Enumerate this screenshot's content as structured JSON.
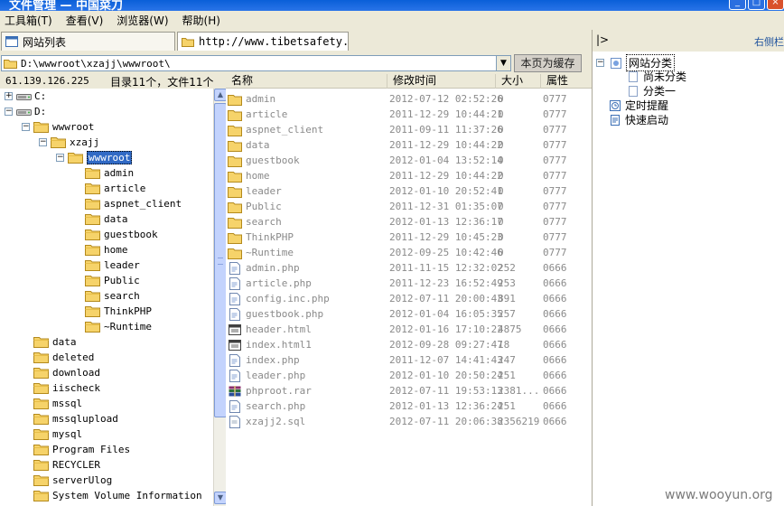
{
  "window": {
    "title": "文件管理 — 中国菜刀"
  },
  "menubar": [
    "工具箱(T)",
    "查看(V)",
    "浏览器(W)",
    "帮助(H)"
  ],
  "tabs": [
    {
      "label": "网站列表",
      "active": false
    },
    {
      "label": "http://www.tibetsafety.g...",
      "active": true
    }
  ],
  "right_panel": {
    "collapse_arrow": "|>",
    "title": "右侧栏",
    "tree": [
      {
        "label": "网站分类",
        "level": 0,
        "icon": "folder-category-icon",
        "expanded": true,
        "selected": true
      },
      {
        "label": "尚未分类",
        "level": 1,
        "icon": "doc-icon"
      },
      {
        "label": "分类一",
        "level": 1,
        "icon": "doc-icon"
      },
      {
        "label": "定时提醒",
        "level": 0,
        "icon": "clock-icon"
      },
      {
        "label": "快速启动",
        "level": 0,
        "icon": "doc-icon"
      }
    ]
  },
  "address": {
    "path": "D:\\wwwroot\\xzajj\\wwwroot\\",
    "cache_button": "本页为缓存"
  },
  "status": {
    "ip": "61.139.126.225",
    "summary": "目录11个，文件11个"
  },
  "tree": [
    {
      "label": "C:",
      "level": 0,
      "type": "drive",
      "toggle": "+"
    },
    {
      "label": "D:",
      "level": 0,
      "type": "drive",
      "toggle": "-"
    },
    {
      "label": "wwwroot",
      "level": 1,
      "type": "folder",
      "toggle": "-"
    },
    {
      "label": "xzajj",
      "level": 2,
      "type": "folder",
      "toggle": "-"
    },
    {
      "label": "wwwroot",
      "level": 3,
      "type": "folder",
      "toggle": "-",
      "selected": true
    },
    {
      "label": "admin",
      "level": 4,
      "type": "folder"
    },
    {
      "label": "article",
      "level": 4,
      "type": "folder"
    },
    {
      "label": "aspnet_client",
      "level": 4,
      "type": "folder"
    },
    {
      "label": "data",
      "level": 4,
      "type": "folder"
    },
    {
      "label": "guestbook",
      "level": 4,
      "type": "folder"
    },
    {
      "label": "home",
      "level": 4,
      "type": "folder"
    },
    {
      "label": "leader",
      "level": 4,
      "type": "folder"
    },
    {
      "label": "Public",
      "level": 4,
      "type": "folder"
    },
    {
      "label": "search",
      "level": 4,
      "type": "folder"
    },
    {
      "label": "ThinkPHP",
      "level": 4,
      "type": "folder"
    },
    {
      "label": "~Runtime",
      "level": 4,
      "type": "folder"
    },
    {
      "label": "data",
      "level": 1,
      "type": "folder"
    },
    {
      "label": "deleted",
      "level": 1,
      "type": "folder"
    },
    {
      "label": "download",
      "level": 1,
      "type": "folder"
    },
    {
      "label": "iischeck",
      "level": 1,
      "type": "folder"
    },
    {
      "label": "mssql",
      "level": 1,
      "type": "folder"
    },
    {
      "label": "mssqlupload",
      "level": 1,
      "type": "folder"
    },
    {
      "label": "mysql",
      "level": 1,
      "type": "folder"
    },
    {
      "label": "Program Files",
      "level": 1,
      "type": "folder"
    },
    {
      "label": "RECYCLER",
      "level": 1,
      "type": "folder"
    },
    {
      "label": "serverUlog",
      "level": 1,
      "type": "folder"
    },
    {
      "label": "System Volume Information",
      "level": 1,
      "type": "folder"
    }
  ],
  "list_columns": [
    "名称",
    "修改时间",
    "大小",
    "属性"
  ],
  "files": [
    {
      "name": "admin",
      "time": "2012-07-12 02:52:26",
      "size": "0",
      "attr": "0777",
      "icon": "folder"
    },
    {
      "name": "article",
      "time": "2011-12-29 10:44:21",
      "size": "0",
      "attr": "0777",
      "icon": "folder"
    },
    {
      "name": "aspnet_client",
      "time": "2011-09-11 11:37:26",
      "size": "0",
      "attr": "0777",
      "icon": "folder"
    },
    {
      "name": "data",
      "time": "2011-12-29 10:44:22",
      "size": "0",
      "attr": "0777",
      "icon": "folder"
    },
    {
      "name": "guestbook",
      "time": "2012-01-04 13:52:14",
      "size": "0",
      "attr": "0777",
      "icon": "folder"
    },
    {
      "name": "home",
      "time": "2011-12-29 10:44:22",
      "size": "0",
      "attr": "0777",
      "icon": "folder"
    },
    {
      "name": "leader",
      "time": "2012-01-10 20:52:41",
      "size": "0",
      "attr": "0777",
      "icon": "folder"
    },
    {
      "name": "Public",
      "time": "2011-12-31 01:35:07",
      "size": "0",
      "attr": "0777",
      "icon": "folder"
    },
    {
      "name": "search",
      "time": "2012-01-13 12:36:17",
      "size": "0",
      "attr": "0777",
      "icon": "folder"
    },
    {
      "name": "ThinkPHP",
      "time": "2011-12-29 10:45:23",
      "size": "0",
      "attr": "0777",
      "icon": "folder"
    },
    {
      "name": "~Runtime",
      "time": "2012-09-25 10:42:46",
      "size": "0",
      "attr": "0777",
      "icon": "folder"
    },
    {
      "name": "admin.php",
      "time": "2011-11-15 12:32:02",
      "size": "252",
      "attr": "0666",
      "icon": "php"
    },
    {
      "name": "article.php",
      "time": "2011-12-23 16:52:49",
      "size": "253",
      "attr": "0666",
      "icon": "php"
    },
    {
      "name": "config.inc.php",
      "time": "2012-07-11 20:00:43",
      "size": "891",
      "attr": "0666",
      "icon": "php"
    },
    {
      "name": "guestbook.php",
      "time": "2012-01-04 16:05:35",
      "size": "257",
      "attr": "0666",
      "icon": "php"
    },
    {
      "name": "header.html",
      "time": "2012-01-16 17:10:22",
      "size": "4875",
      "attr": "0666",
      "icon": "html"
    },
    {
      "name": "index.html1",
      "time": "2012-09-28 09:27:47",
      "size": "18",
      "attr": "0666",
      "icon": "html"
    },
    {
      "name": "index.php",
      "time": "2011-12-07 14:41:43",
      "size": "247",
      "attr": "0666",
      "icon": "php"
    },
    {
      "name": "leader.php",
      "time": "2012-01-10 20:50:24",
      "size": "251",
      "attr": "0666",
      "icon": "php"
    },
    {
      "name": "phproot.rar",
      "time": "2012-07-11 19:53:13",
      "size": "2381...",
      "attr": "0666",
      "icon": "rar"
    },
    {
      "name": "search.php",
      "time": "2012-01-13 12:36:24",
      "size": "251",
      "attr": "0666",
      "icon": "php"
    },
    {
      "name": "xzajj2.sql",
      "time": "2012-07-11 20:06:38",
      "size": "2356219",
      "attr": "0666",
      "icon": "doc"
    }
  ],
  "watermark": "www.wooyun.org"
}
